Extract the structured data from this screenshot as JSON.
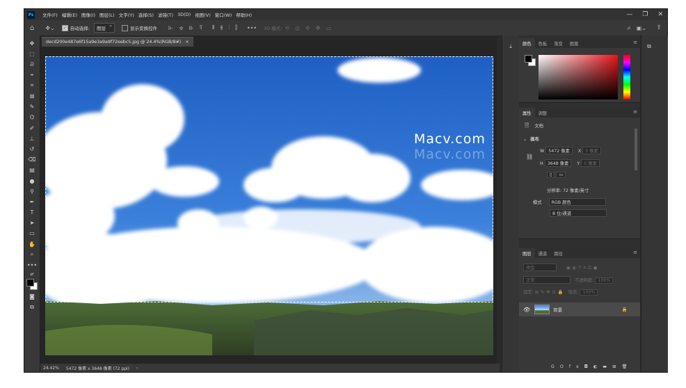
{
  "menubar": {
    "logo": "Ps",
    "items": [
      "文件(F)",
      "编辑(E)",
      "图像(I)",
      "图层(L)",
      "文字(Y)",
      "选择(S)",
      "滤镜(T)",
      "3D(D)",
      "视图(V)",
      "窗口(W)",
      "帮助(H)"
    ],
    "window_controls": [
      "—",
      "❐",
      "✕"
    ]
  },
  "options_bar": {
    "auto_select_label": "自动选择:",
    "auto_select_value": "图层",
    "show_transform_label": "显示变换控件",
    "mode_3d_label": "3D 模式:",
    "more": "•••"
  },
  "document": {
    "tab_title": "decd200e487e6f15a9e3a9a9f72eebc5.jpg @ 24.4%(RGB/8#)",
    "tab_close": "×",
    "watermark_text": "Macv.com"
  },
  "status_bar": {
    "zoom": "24.42%",
    "doc_info": "5472 像素 x 3648 像素 (72 ppi)",
    "arrow": "›"
  },
  "color_panel": {
    "tabs": [
      "颜色",
      "色板",
      "渐变",
      "图案"
    ],
    "active_tab": "颜色"
  },
  "properties_panel": {
    "tabs": [
      "属性",
      "调整"
    ],
    "active_tab": "属性",
    "doc_label": "文档",
    "section": "画布",
    "w_label": "W",
    "w_value": "5472 像素",
    "x_label": "X",
    "x_value": "0 像素",
    "h_label": "H",
    "h_value": "3648 像素",
    "y_label": "Y",
    "y_value": "0 像素",
    "resolution": "分辨率: 72 像素/英寸",
    "mode_label": "模式",
    "mode_value": "RGB 颜色",
    "depth_value": "8 位/通道"
  },
  "layers_panel": {
    "tabs": [
      "图层",
      "通道",
      "路径"
    ],
    "active_tab": "图层",
    "filter_kind": "类型",
    "blend_mode": "正常",
    "opacity_label": "不透明度:",
    "opacity_value": "100%",
    "lock_label": "锁定:",
    "fill_label": "填充:",
    "fill_value": "100%",
    "layer_name": "背景",
    "bottom_icons": [
      "GO",
      "fx",
      "◘",
      "◐",
      "▬",
      "⊞",
      "🗑"
    ]
  },
  "colors": {
    "app_bg": "#2b2b2b",
    "sky": "#2b6fcf",
    "fg_swatch": "#000000",
    "bg_swatch": "#ffffff"
  }
}
